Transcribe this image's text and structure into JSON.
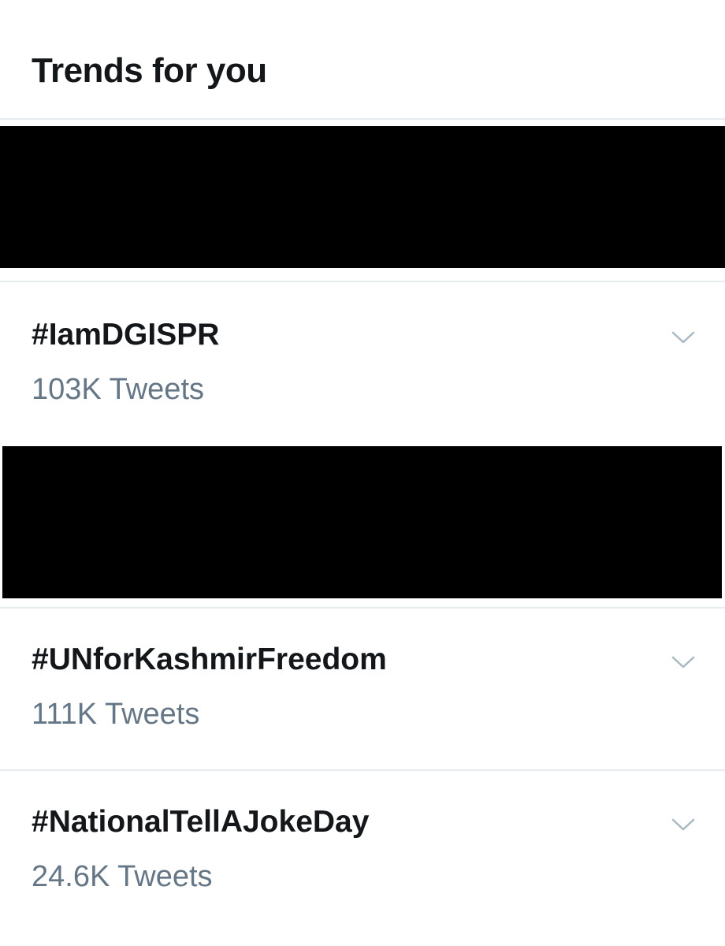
{
  "header": {
    "title": "Trends for you"
  },
  "trends": [
    {
      "name": "#IamDGISPR",
      "count": "103K Tweets",
      "menu_icon": "chevron-down-icon"
    },
    {
      "name": "#UNforKashmirFreedom",
      "count": "111K Tweets",
      "menu_icon": "chevron-down-icon"
    },
    {
      "name": "#NationalTellAJokeDay",
      "count": "24.6K Tweets",
      "menu_icon": "chevron-down-icon"
    }
  ],
  "colors": {
    "primary_text": "#14171a",
    "secondary_text": "#657786",
    "divider": "#e6ecf0",
    "chevron": "#aab8c2",
    "redaction": "#000000"
  }
}
